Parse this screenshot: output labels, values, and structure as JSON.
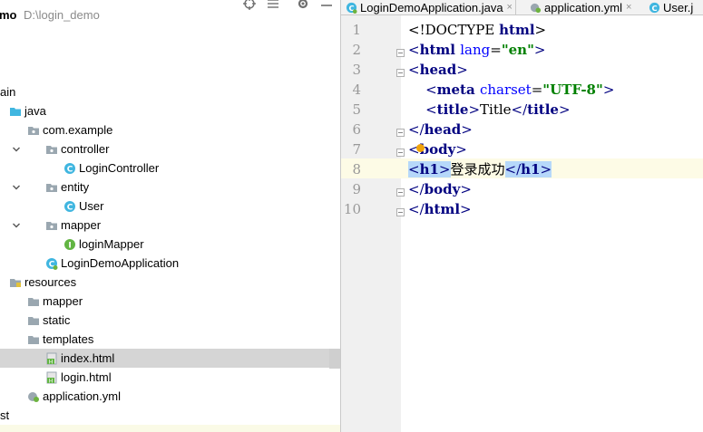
{
  "project": {
    "root_name": "mo",
    "root_path": "D:\\login_demo",
    "header_icons": [
      "target-icon",
      "collapse-all-icon",
      "gear-icon",
      "minimize-icon"
    ],
    "tree": [
      {
        "label": "ain",
        "icon": "none",
        "arrow": "",
        "indent": -7
      },
      {
        "label": "java",
        "icon": "folder-blue",
        "arrow": "",
        "indent": 7
      },
      {
        "label": "com.example",
        "icon": "package",
        "arrow": "",
        "indent": 27
      },
      {
        "label": "controller",
        "icon": "package",
        "arrow": "down",
        "indent": 47
      },
      {
        "label": "LoginController",
        "icon": "class",
        "arrow": "",
        "indent": 67
      },
      {
        "label": "entity",
        "icon": "package",
        "arrow": "down",
        "indent": 47
      },
      {
        "label": "User",
        "icon": "class",
        "arrow": "",
        "indent": 67
      },
      {
        "label": "mapper",
        "icon": "package",
        "arrow": "down",
        "indent": 47
      },
      {
        "label": "loginMapper",
        "icon": "interface",
        "arrow": "",
        "indent": 67
      },
      {
        "label": "LoginDemoApplication",
        "icon": "spring-class",
        "arrow": "",
        "indent": 47
      },
      {
        "label": "resources",
        "icon": "folder-res",
        "arrow": "",
        "indent": 7
      },
      {
        "label": "mapper",
        "icon": "folder",
        "arrow": "",
        "indent": 27
      },
      {
        "label": "static",
        "icon": "folder",
        "arrow": "",
        "indent": 27
      },
      {
        "label": "templates",
        "icon": "folder",
        "arrow": "",
        "indent": 27
      },
      {
        "label": "index.html",
        "icon": "html",
        "arrow": "",
        "indent": 47,
        "selected": true
      },
      {
        "label": "login.html",
        "icon": "html",
        "arrow": "",
        "indent": 47
      },
      {
        "label": "application.yml",
        "icon": "yml",
        "arrow": "",
        "indent": 27
      },
      {
        "label": "st",
        "icon": "none",
        "arrow": "",
        "indent": -7
      }
    ]
  },
  "tabs": [
    {
      "label": "LoginDemoApplication.java",
      "icon": "spring-class",
      "close": "×"
    },
    {
      "label": "application.yml",
      "icon": "yml",
      "close": "×"
    },
    {
      "label": "User.j",
      "icon": "class",
      "close": ""
    }
  ],
  "editor": {
    "line_numbers": [
      "1",
      "2",
      "3",
      "4",
      "5",
      "6",
      "7",
      "8",
      "9",
      "10"
    ],
    "lines": [
      [
        {
          "t": "<!DOCTYPE ",
          "c": "tx"
        },
        {
          "t": "html",
          "c": "tn"
        },
        {
          "t": ">",
          "c": "tx"
        }
      ],
      [
        {
          "t": "<",
          "c": "tg"
        },
        {
          "t": "html ",
          "c": "tn"
        },
        {
          "t": "lang",
          "c": "an"
        },
        {
          "t": "=",
          "c": "tx"
        },
        {
          "t": "\"en\"",
          "c": "av"
        },
        {
          "t": ">",
          "c": "tg"
        }
      ],
      [
        {
          "t": "<",
          "c": "tg"
        },
        {
          "t": "head",
          "c": "tn"
        },
        {
          "t": ">",
          "c": "tg"
        }
      ],
      [
        {
          "t": "    <",
          "c": "tg"
        },
        {
          "t": "meta ",
          "c": "tn"
        },
        {
          "t": "charset",
          "c": "an"
        },
        {
          "t": "=",
          "c": "tx"
        },
        {
          "t": "\"UTF-8\"",
          "c": "av"
        },
        {
          "t": ">",
          "c": "tg"
        }
      ],
      [
        {
          "t": "    <",
          "c": "tg"
        },
        {
          "t": "title",
          "c": "tn"
        },
        {
          "t": ">",
          "c": "tg"
        },
        {
          "t": "Title",
          "c": "tx"
        },
        {
          "t": "</",
          "c": "tg"
        },
        {
          "t": "title",
          "c": "tn"
        },
        {
          "t": ">",
          "c": "tg"
        }
      ],
      [
        {
          "t": "</",
          "c": "tg"
        },
        {
          "t": "head",
          "c": "tn"
        },
        {
          "t": ">",
          "c": "tg"
        }
      ],
      [
        {
          "t": "<",
          "c": "tg"
        },
        {
          "t": "body",
          "c": "tn"
        },
        {
          "t": ">",
          "c": "tg"
        }
      ],
      [
        {
          "t": "<",
          "c": "tg hl"
        },
        {
          "t": "h1",
          "c": "tn hl"
        },
        {
          "t": ">",
          "c": "tg hl"
        },
        {
          "t": "登录成功",
          "c": "tx"
        },
        {
          "t": "</",
          "c": "tg hl"
        },
        {
          "t": "h1",
          "c": "tn hl"
        },
        {
          "t": ">",
          "c": "tg hl"
        }
      ],
      [
        {
          "t": "</",
          "c": "tg"
        },
        {
          "t": "body",
          "c": "tn"
        },
        {
          "t": ">",
          "c": "tg"
        }
      ],
      [
        {
          "t": "</",
          "c": "tg"
        },
        {
          "t": "html",
          "c": "tn"
        },
        {
          "t": ">",
          "c": "tg"
        }
      ]
    ],
    "current_line": 8
  },
  "colors": {
    "selection": "#d5d5d5",
    "tag": "#000080",
    "attr_name": "#0000ff",
    "attr_value": "#008000",
    "match_highlight": "#b6d8fa",
    "current_line": "#fdfbe6"
  }
}
